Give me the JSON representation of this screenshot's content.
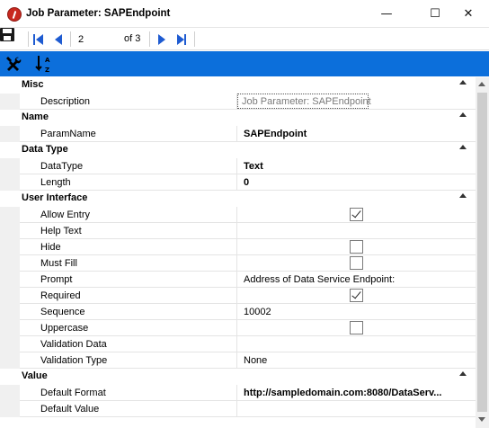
{
  "window": {
    "title": "Job Parameter: SAPEndpoint",
    "minimize_glyph": "—",
    "maximize_glyph": "☐",
    "close_glyph": "✕"
  },
  "navigator": {
    "position": "2",
    "of_label": "of 3"
  },
  "grid": {
    "categories": {
      "misc": "Misc",
      "name": "Name",
      "data_type": "Data Type",
      "user_interface": "User Interface",
      "value": "Value"
    },
    "rows": {
      "description": {
        "label": "Description",
        "value": "Job Parameter: SAPEndpoint"
      },
      "param_name": {
        "label": "ParamName",
        "value": "SAPEndpoint"
      },
      "data_type": {
        "label": "DataType",
        "value": "Text"
      },
      "length": {
        "label": "Length",
        "value": "0"
      },
      "allow_entry": {
        "label": "Allow Entry",
        "checked": true
      },
      "help_text": {
        "label": "Help Text",
        "value": ""
      },
      "hide": {
        "label": "Hide",
        "checked": false
      },
      "must_fill": {
        "label": "Must Fill",
        "checked": false
      },
      "prompt": {
        "label": "Prompt",
        "value": "Address of Data Service Endpoint:"
      },
      "required": {
        "label": "Required",
        "checked": true
      },
      "sequence": {
        "label": "Sequence",
        "value": "10002"
      },
      "uppercase": {
        "label": "Uppercase",
        "checked": false
      },
      "validation_data": {
        "label": "Validation Data",
        "value": ""
      },
      "validation_type": {
        "label": "Validation Type",
        "value": "None"
      },
      "default_format": {
        "label": "Default Format",
        "value": "http://sampledomain.com:8080/DataServ..."
      },
      "default_value": {
        "label": "Default Value",
        "value": ""
      }
    }
  }
}
